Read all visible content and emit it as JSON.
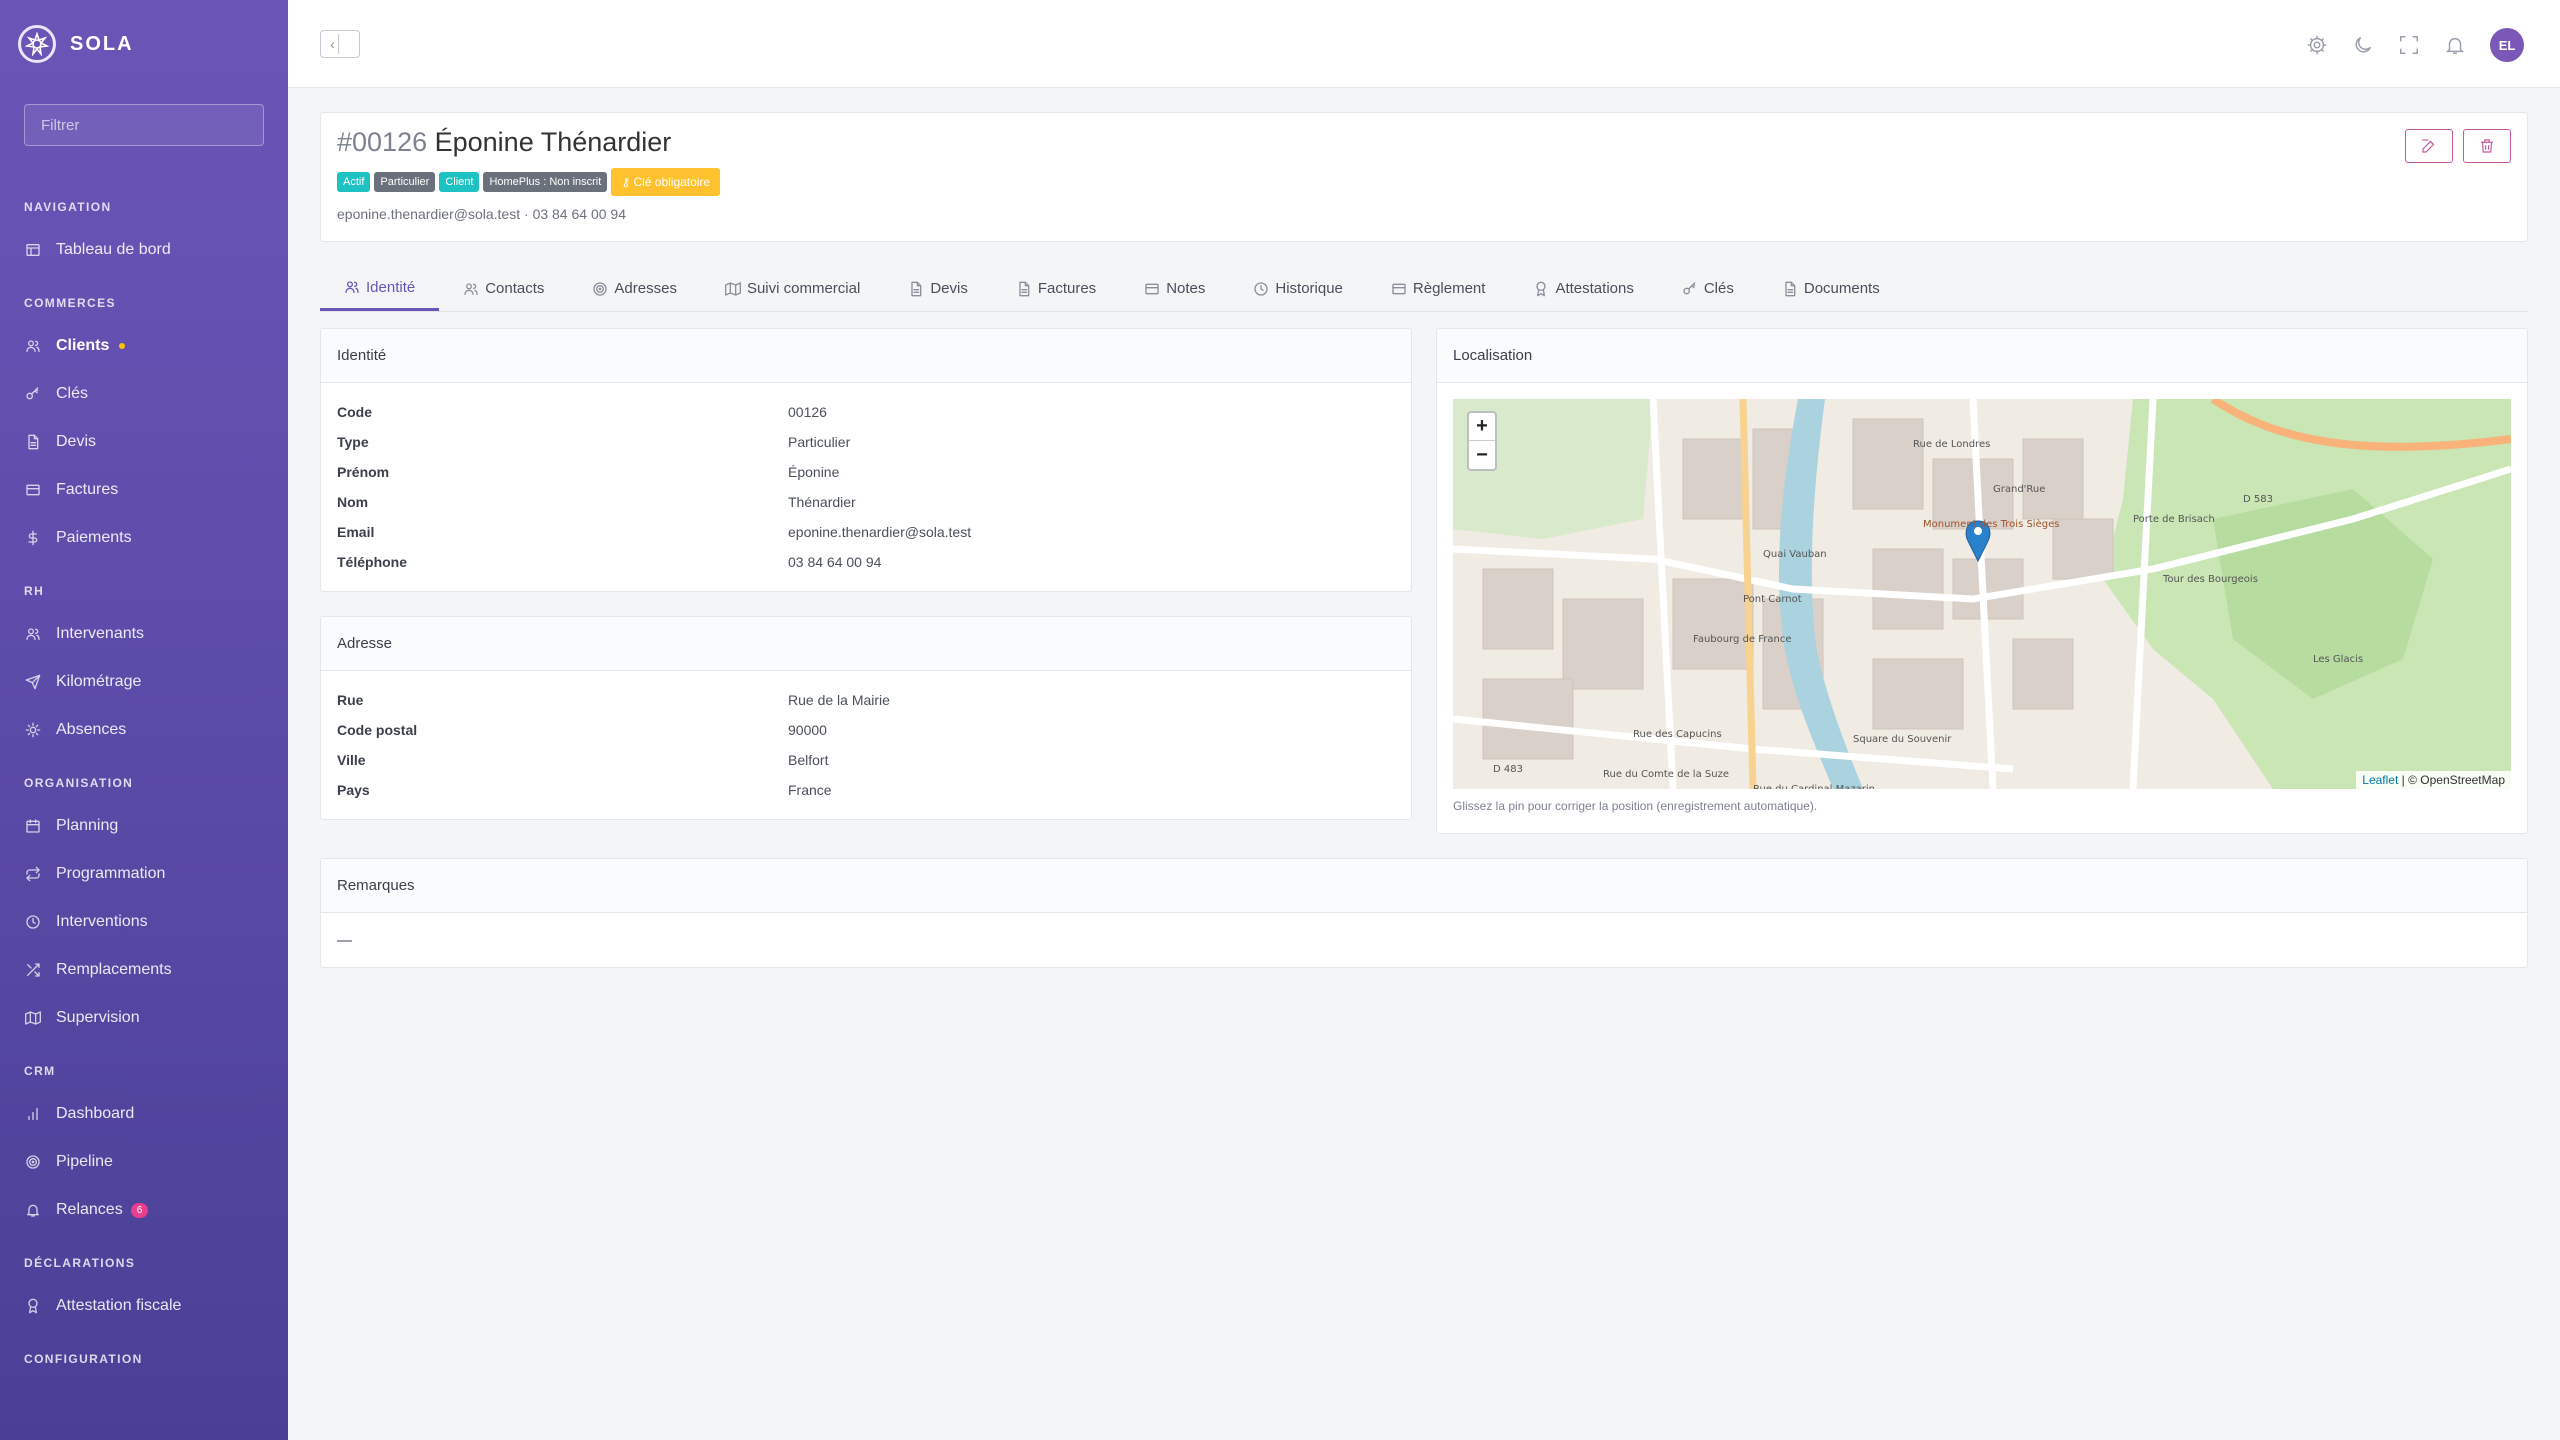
{
  "brand": {
    "name": "SOLA"
  },
  "sidebar": {
    "filter_placeholder": "Filtrer",
    "sections": [
      {
        "title": "NAVIGATION",
        "items": [
          {
            "label": "Tableau de bord",
            "icon": "dashboard-icon"
          }
        ]
      },
      {
        "title": "COMMERCES",
        "items": [
          {
            "label": "Clients",
            "icon": "users-icon",
            "active": true
          },
          {
            "label": "Clés",
            "icon": "key-icon"
          },
          {
            "label": "Devis",
            "icon": "file-icon"
          },
          {
            "label": "Factures",
            "icon": "invoice-icon"
          },
          {
            "label": "Paiements",
            "icon": "dollar-icon"
          }
        ]
      },
      {
        "title": "RH",
        "items": [
          {
            "label": "Intervenants",
            "icon": "users-icon"
          },
          {
            "label": "Kilométrage",
            "icon": "send-icon"
          },
          {
            "label": "Absences",
            "icon": "sun-icon"
          }
        ]
      },
      {
        "title": "ORGANISATION",
        "items": [
          {
            "label": "Planning",
            "icon": "calendar-icon"
          },
          {
            "label": "Programmation",
            "icon": "repeat-icon"
          },
          {
            "label": "Interventions",
            "icon": "clock-icon"
          },
          {
            "label": "Remplacements",
            "icon": "shuffle-icon"
          },
          {
            "label": "Supervision",
            "icon": "map-icon"
          }
        ]
      },
      {
        "title": "CRM",
        "items": [
          {
            "label": "Dashboard",
            "icon": "bar-chart-icon"
          },
          {
            "label": "Pipeline",
            "icon": "target-icon"
          },
          {
            "label": "Relances",
            "icon": "bell-icon",
            "badge": "6"
          }
        ]
      },
      {
        "title": "DÉCLARATIONS",
        "items": [
          {
            "label": "Attestation fiscale",
            "icon": "award-icon"
          }
        ]
      },
      {
        "title": "CONFIGURATION",
        "items": []
      }
    ]
  },
  "topbar": {
    "avatar_initials": "EL"
  },
  "client": {
    "code": "#00126",
    "name": "Éponine Thénardier",
    "badges": [
      "Actif",
      "Particulier",
      "Client",
      "HomePlus : Non inscrit"
    ],
    "key_badge": "Clé obligatoire",
    "email": "eponine.thenardier@sola.test",
    "phone": "03 84 64 00 94",
    "contact_sep": " · "
  },
  "tabs": [
    "Identité",
    "Contacts",
    "Adresses",
    "Suivi commercial",
    "Devis",
    "Factures",
    "Notes",
    "Historique",
    "Règlement",
    "Attestations",
    "Clés",
    "Documents"
  ],
  "identity": {
    "title": "Identité",
    "rows": [
      {
        "k": "Code",
        "v": "00126"
      },
      {
        "k": "Type",
        "v": "Particulier"
      },
      {
        "k": "Prénom",
        "v": "Éponine"
      },
      {
        "k": "Nom",
        "v": "Thénardier"
      },
      {
        "k": "Email",
        "v": "eponine.thenardier@sola.test"
      },
      {
        "k": "Téléphone",
        "v": "03 84 64 00 94"
      }
    ]
  },
  "address": {
    "title": "Adresse",
    "rows": [
      {
        "k": "Rue",
        "v": "Rue de la Mairie"
      },
      {
        "k": "Code postal",
        "v": "90000"
      },
      {
        "k": "Ville",
        "v": "Belfort"
      },
      {
        "k": "Pays",
        "v": "France"
      }
    ]
  },
  "location": {
    "title": "Localisation",
    "zoom_in": "+",
    "zoom_out": "−",
    "attribution_leaflet": "Leaflet",
    "attribution_rest": " | © OpenStreetMap",
    "hint": "Glissez la pin pour corriger la position (enregistrement automatique).",
    "labels": [
      "Pont Carnot",
      "Monument des Trois Sièges",
      "Porte de Brisach",
      "Tour des Bourgeois",
      "Les Glacis",
      "Grand'Rue",
      "Faubourg de France",
      "Quai Vauban",
      "Rue des Capucins",
      "Rue du Comte de la Suze",
      "Rue du Cardinal Mazarin",
      "Square du Souvenir",
      "D 483",
      "D 583",
      "Rue de Londres"
    ]
  },
  "remarks": {
    "title": "Remarques",
    "value": "—"
  },
  "colors": {
    "accent": "#6a55b7",
    "teal": "#1fc2c2",
    "grey": "#6b717c",
    "yellow": "#ffc22e",
    "danger": "#c35aa0"
  }
}
